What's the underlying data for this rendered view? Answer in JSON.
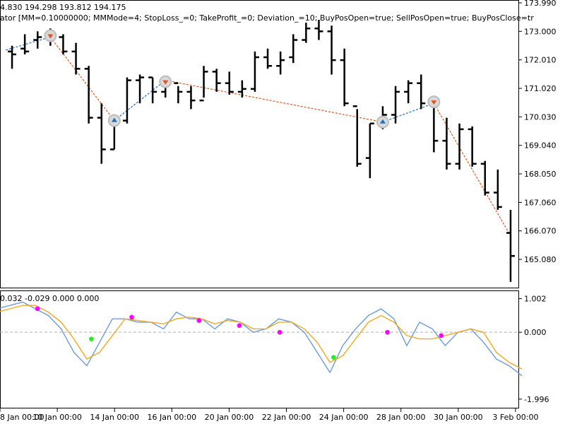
{
  "header": {
    "ohlc_line": "4.830 194.298 193.812 194.175",
    "params_line": "ator [MM=0.10000000; MMMode=4; StopLoss_=0; TakeProfit_=0; Deviation_=10; BuyPosOpen=true; SellPosOpen=true; BuyPosClose=tr",
    "indicator_values": "0.032 -0.029 0.000 0.000"
  },
  "chart_data": [
    {
      "type": "ohlc",
      "title": "",
      "ylim": [
        164.1,
        173.99
      ],
      "yticks": [
        "173.990",
        "173.000",
        "172.010",
        "171.020",
        "170.030",
        "169.040",
        "168.050",
        "167.060",
        "166.070",
        "165.080"
      ],
      "bars": [
        {
          "h": 172.5,
          "l": 171.7,
          "o": 172.3,
          "c": 172.2
        },
        {
          "h": 172.9,
          "l": 172.2,
          "o": 172.4,
          "c": 172.3
        },
        {
          "h": 173.0,
          "l": 172.4,
          "o": 172.7,
          "c": 172.8
        },
        {
          "h": 173.1,
          "l": 172.5,
          "o": 172.9,
          "c": 172.9
        },
        {
          "h": 172.9,
          "l": 172.2,
          "o": 172.8,
          "c": 172.3
        },
        {
          "h": 172.6,
          "l": 171.5,
          "o": 172.3,
          "c": 171.7
        },
        {
          "h": 171.8,
          "l": 169.8,
          "o": 171.7,
          "c": 170.0
        },
        {
          "h": 170.5,
          "l": 168.4,
          "o": 170.0,
          "c": 168.9
        },
        {
          "h": 170.1,
          "l": 168.9,
          "o": 168.9,
          "c": 169.9
        },
        {
          "h": 171.4,
          "l": 169.8,
          "o": 169.9,
          "c": 171.3
        },
        {
          "h": 171.5,
          "l": 170.5,
          "o": 171.3,
          "c": 171.4
        },
        {
          "h": 171.4,
          "l": 170.5,
          "o": 171.4,
          "c": 170.9
        },
        {
          "h": 171.3,
          "l": 170.7,
          "o": 170.9,
          "c": 171.2
        },
        {
          "h": 171.1,
          "l": 170.5,
          "o": 171.2,
          "c": 170.9
        },
        {
          "h": 171.1,
          "l": 170.3,
          "o": 170.9,
          "c": 170.6
        },
        {
          "h": 171.8,
          "l": 170.7,
          "o": 170.6,
          "c": 171.6
        },
        {
          "h": 171.7,
          "l": 170.9,
          "o": 171.6,
          "c": 171.2
        },
        {
          "h": 171.6,
          "l": 170.8,
          "o": 171.2,
          "c": 170.9
        },
        {
          "h": 171.3,
          "l": 170.7,
          "o": 170.9,
          "c": 171.0
        },
        {
          "h": 172.3,
          "l": 170.9,
          "o": 171.0,
          "c": 172.1
        },
        {
          "h": 172.4,
          "l": 171.7,
          "o": 172.1,
          "c": 171.8
        },
        {
          "h": 172.3,
          "l": 171.5,
          "o": 171.8,
          "c": 172.0
        },
        {
          "h": 172.9,
          "l": 171.9,
          "o": 172.1,
          "c": 172.7
        },
        {
          "h": 173.3,
          "l": 172.6,
          "o": 172.7,
          "c": 173.1
        },
        {
          "h": 173.4,
          "l": 172.7,
          "o": 173.1,
          "c": 173.0
        },
        {
          "h": 173.2,
          "l": 171.5,
          "o": 173.0,
          "c": 172.0
        },
        {
          "h": 172.4,
          "l": 170.4,
          "o": 172.0,
          "c": 170.5
        },
        {
          "h": 170.3,
          "l": 168.3,
          "o": 170.4,
          "c": 168.4
        },
        {
          "h": 169.8,
          "l": 167.9,
          "o": 168.6,
          "c": 169.8
        },
        {
          "h": 170.4,
          "l": 169.6,
          "o": 169.8,
          "c": 170.1
        },
        {
          "h": 171.1,
          "l": 169.8,
          "o": 170.1,
          "c": 170.9
        },
        {
          "h": 171.3,
          "l": 170.5,
          "o": 170.9,
          "c": 171.2
        },
        {
          "h": 171.5,
          "l": 170.3,
          "o": 171.2,
          "c": 170.5
        },
        {
          "h": 170.7,
          "l": 168.8,
          "o": 170.5,
          "c": 169.2
        },
        {
          "h": 170.0,
          "l": 168.2,
          "o": 169.2,
          "c": 168.4
        },
        {
          "h": 169.8,
          "l": 168.2,
          "o": 168.4,
          "c": 169.6
        },
        {
          "h": 169.7,
          "l": 168.3,
          "o": 169.6,
          "c": 168.4
        },
        {
          "h": 168.5,
          "l": 167.3,
          "o": 168.4,
          "c": 167.4
        },
        {
          "h": 168.2,
          "l": 166.8,
          "o": 167.4,
          "c": 166.9
        },
        {
          "h": 166.8,
          "l": 164.3,
          "o": 166.0,
          "c": 165.2
        }
      ],
      "trade_arrows": [
        {
          "bar": 3,
          "price": 172.85,
          "side": "sell"
        },
        {
          "bar": 8,
          "price": 169.9,
          "side": "buy"
        },
        {
          "bar": 12,
          "price": 171.25,
          "side": "sell"
        },
        {
          "bar": 29,
          "price": 169.85,
          "side": "buy"
        },
        {
          "bar": 33,
          "price": 170.55,
          "side": "sell"
        }
      ],
      "trade_links": [
        {
          "from": [
            -0.5,
            172.35
          ],
          "to": [
            3,
            172.8
          ],
          "color": "#1f6fc0"
        },
        {
          "from": [
            3,
            172.8
          ],
          "to": [
            8,
            169.9
          ],
          "color": "#e2541f"
        },
        {
          "from": [
            8,
            169.9
          ],
          "to": [
            12,
            171.3
          ],
          "color": "#1f6fc0"
        },
        {
          "from": [
            12,
            171.3
          ],
          "to": [
            29,
            169.85
          ],
          "color": "#e2541f"
        },
        {
          "from": [
            29,
            169.85
          ],
          "to": [
            33,
            170.5
          ],
          "color": "#1f6fc0"
        },
        {
          "from": [
            33,
            170.5
          ],
          "to": [
            39,
            165.9
          ],
          "color": "#e2541f"
        }
      ]
    },
    {
      "type": "line",
      "title": "",
      "ylim": [
        -2.0,
        1.1
      ],
      "yticks": [
        "1.002",
        "0.000",
        "-1.996"
      ],
      "reference_line": 0.0,
      "series": [
        {
          "name": "",
          "color": "#6c9bd9",
          "values": [
            0.7,
            0.8,
            0.9,
            0.7,
            0.5,
            0.1,
            -0.6,
            -1.0,
            -0.3,
            0.4,
            0.4,
            0.3,
            0.3,
            0.1,
            0.6,
            0.4,
            0.4,
            0.1,
            0.4,
            0.3,
            0.0,
            0.1,
            0.4,
            0.3,
            0.0,
            -0.6,
            -1.2,
            -0.4,
            0.1,
            0.5,
            0.7,
            0.4,
            -0.4,
            0.3,
            0.1,
            -0.4,
            0.0,
            0.1,
            -0.3,
            -0.8,
            -1.0,
            -1.3
          ]
        },
        {
          "name": "",
          "color": "#f5a623",
          "values": [
            0.6,
            0.7,
            0.8,
            0.8,
            0.6,
            0.3,
            -0.2,
            -0.8,
            -0.6,
            -0.1,
            0.4,
            0.35,
            0.3,
            0.25,
            0.4,
            0.45,
            0.4,
            0.25,
            0.35,
            0.3,
            0.1,
            0.1,
            0.3,
            0.3,
            0.1,
            -0.3,
            -0.9,
            -0.7,
            -0.2,
            0.3,
            0.5,
            0.3,
            -0.1,
            -0.2,
            -0.2,
            -0.1,
            0.0,
            0.1,
            0.0,
            -0.6,
            -0.9,
            -1.1
          ]
        }
      ],
      "signal_dots": [
        {
          "x": 3,
          "y": 0.7,
          "color": "#ff00ff"
        },
        {
          "x": 7,
          "y": -0.2,
          "color": "#22ee22"
        },
        {
          "x": 10,
          "y": 0.45,
          "color": "#ff00ff"
        },
        {
          "x": 15,
          "y": 0.35,
          "color": "#ff00ff"
        },
        {
          "x": 18,
          "y": 0.2,
          "color": "#ff00ff"
        },
        {
          "x": 21,
          "y": 0.0,
          "color": "#ff00ff"
        },
        {
          "x": 25,
          "y": -0.75,
          "color": "#22ee22"
        },
        {
          "x": 29,
          "y": 0.0,
          "color": "#ff00ff"
        },
        {
          "x": 33,
          "y": -0.1,
          "color": "#ff00ff"
        }
      ],
      "xticks": [
        "8 Jan 00:00",
        "10 Jan 00:00",
        "14 Jan 00:00",
        "16 Jan 00:00",
        "20 Jan 00:00",
        "22 Jan 00:00",
        "24 Jan 00:00",
        "28 Jan 00:00",
        "30 Jan 00:00",
        "3 Feb 00:00"
      ]
    }
  ],
  "colors": {
    "bars": "#000000",
    "grid": "#000000",
    "zero_line": "#b0b0b0",
    "arrow_sell": "#e2541f",
    "arrow_buy": "#1f6fc0",
    "marker_ring": "#bdbdbd"
  }
}
